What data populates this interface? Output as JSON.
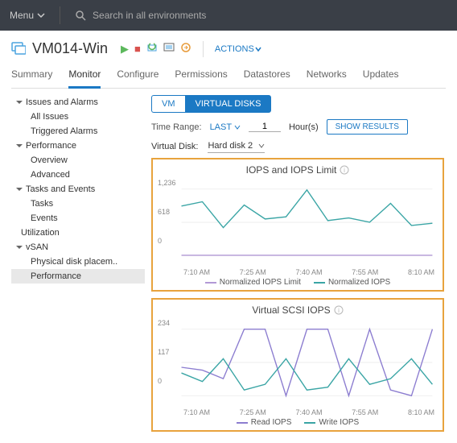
{
  "topbar": {
    "menu_label": "Menu",
    "search_placeholder": "Search in all environments"
  },
  "vm": {
    "title": "VM014-Win",
    "actions_label": "ACTIONS"
  },
  "tabs": [
    "Summary",
    "Monitor",
    "Configure",
    "Permissions",
    "Datastores",
    "Networks",
    "Updates"
  ],
  "active_tab": "Monitor",
  "sidebar": {
    "groups": [
      {
        "label": "Issues and Alarms",
        "items": [
          "All Issues",
          "Triggered Alarms"
        ]
      },
      {
        "label": "Performance",
        "items": [
          "Overview",
          "Advanced"
        ]
      },
      {
        "label": "Tasks and Events",
        "items": [
          "Tasks",
          "Events"
        ]
      }
    ],
    "utilization": "Utilization",
    "vsan": {
      "label": "vSAN",
      "items": [
        "Physical disk placem..",
        "Performance"
      ]
    }
  },
  "panel": {
    "seg_tabs": {
      "vm": "VM",
      "vdisks": "VIRTUAL DISKS"
    },
    "time_range_label": "Time Range:",
    "last_label": "LAST",
    "hours_value": "1",
    "hours_unit": "Hour(s)",
    "show_results": "SHOW RESULTS",
    "vd_label": "Virtual Disk:",
    "vd_value": "Hard disk 2"
  },
  "chart_data": [
    {
      "type": "line",
      "title": "IOPS and IOPS Limit",
      "xlabels": [
        "7:10 AM",
        "7:25 AM",
        "7:40 AM",
        "7:55 AM",
        "8:10 AM"
      ],
      "ylim": [
        0,
        1236
      ],
      "yticks": [
        0,
        618,
        1236
      ],
      "series": [
        {
          "name": "Normalized IOPS Limit",
          "color": "#b299d6",
          "values": [
            5,
            5,
            5,
            5,
            5,
            5,
            5,
            5,
            5,
            5,
            5,
            5,
            5
          ]
        },
        {
          "name": "Normalized IOPS",
          "color": "#3aa5a5",
          "values": [
            920,
            1000,
            520,
            940,
            680,
            720,
            1220,
            650,
            700,
            620,
            970,
            560,
            600
          ]
        }
      ]
    },
    {
      "type": "line",
      "title": "Virtual SCSI IOPS",
      "xlabels": [
        "7:10 AM",
        "7:25 AM",
        "7:40 AM",
        "7:55 AM",
        "8:10 AM"
      ],
      "ylim": [
        0,
        234
      ],
      "yticks": [
        0,
        117,
        234
      ],
      "series": [
        {
          "name": "Read IOPS",
          "color": "#8c7dd0",
          "values": [
            100,
            90,
            60,
            234,
            234,
            0,
            234,
            234,
            0,
            234,
            20,
            0,
            234
          ]
        },
        {
          "name": "Write IOPS",
          "color": "#3aa5a5",
          "values": [
            80,
            50,
            130,
            20,
            40,
            130,
            20,
            30,
            130,
            40,
            60,
            130,
            40
          ]
        }
      ]
    }
  ]
}
